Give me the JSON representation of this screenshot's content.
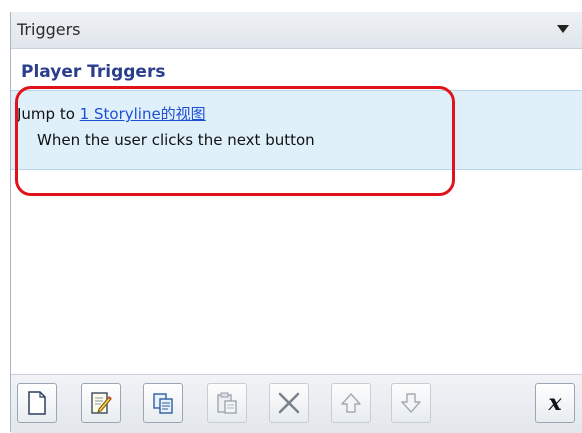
{
  "panel": {
    "title": "Triggers",
    "dropdown_icon": "chevron-down-icon"
  },
  "section": {
    "label": "Player Triggers"
  },
  "trigger": {
    "action": "Jump to ",
    "target": "1 Storyline的视图",
    "condition": "When the user clicks the next button"
  },
  "toolbar": {
    "buttons": [
      {
        "name": "new-trigger-button",
        "icon": "new-document-icon"
      },
      {
        "name": "edit-trigger-button",
        "icon": "edit-icon"
      },
      {
        "name": "copy-trigger-button",
        "icon": "copy-icon"
      },
      {
        "name": "paste-trigger-button",
        "icon": "paste-icon"
      },
      {
        "name": "delete-trigger-button",
        "icon": "delete-x-icon"
      },
      {
        "name": "move-up-button",
        "icon": "arrow-up-icon"
      },
      {
        "name": "move-down-button",
        "icon": "arrow-down-icon"
      },
      {
        "name": "variables-button",
        "icon": "variable-x-icon",
        "label": "x"
      }
    ]
  },
  "colors": {
    "accent": "#2a3d8e",
    "link": "#1d4fd6",
    "selection": "#dff0fb",
    "highlight": "#e0131b"
  }
}
